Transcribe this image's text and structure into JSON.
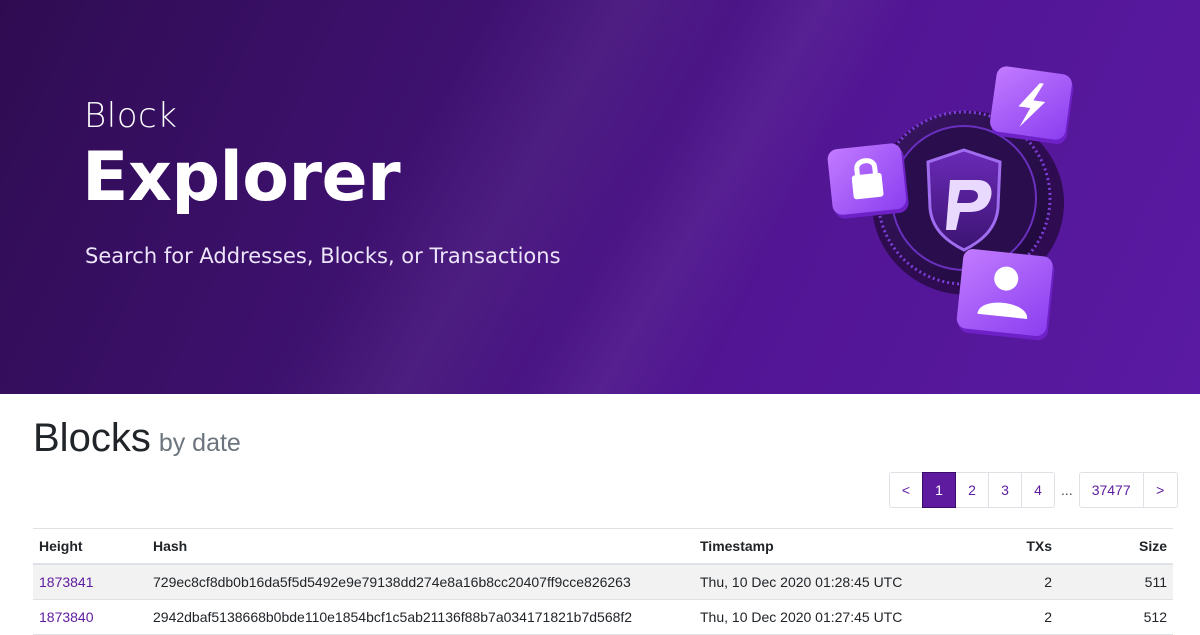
{
  "hero": {
    "subtitle": "Block",
    "title": "Explorer",
    "tagline": "Search for Addresses, Blocks, or Transactions"
  },
  "icons": {
    "main": "pivx-logo-icon",
    "top": "lightning-icon",
    "left": "lock-icon",
    "bottom": "user-icon"
  },
  "colors": {
    "brand": "#5e1b9f",
    "hero_bg": "#3e1170"
  },
  "page": {
    "heading": "Blocks",
    "subheading": "by date"
  },
  "pagination": {
    "prev": "<",
    "pages": [
      "1",
      "2",
      "3",
      "4"
    ],
    "active": "1",
    "ellipsis": "...",
    "last": "37477",
    "next": ">"
  },
  "table": {
    "headers": {
      "height": "Height",
      "hash": "Hash",
      "timestamp": "Timestamp",
      "txs": "TXs",
      "size": "Size"
    },
    "rows": [
      {
        "height": "1873841",
        "hash": "729ec8cf8db0b16da5f5d5492e9e79138dd274e8a16b8cc20407ff9cce826263",
        "timestamp": "Thu, 10 Dec 2020 01:28:45 UTC",
        "txs": "2",
        "size": "511"
      },
      {
        "height": "1873840",
        "hash": "2942dbaf5138668b0bde110e1854bcf1c5ab21136f88b7a034171821b7d568f2",
        "timestamp": "Thu, 10 Dec 2020 01:27:45 UTC",
        "txs": "2",
        "size": "512"
      }
    ]
  }
}
